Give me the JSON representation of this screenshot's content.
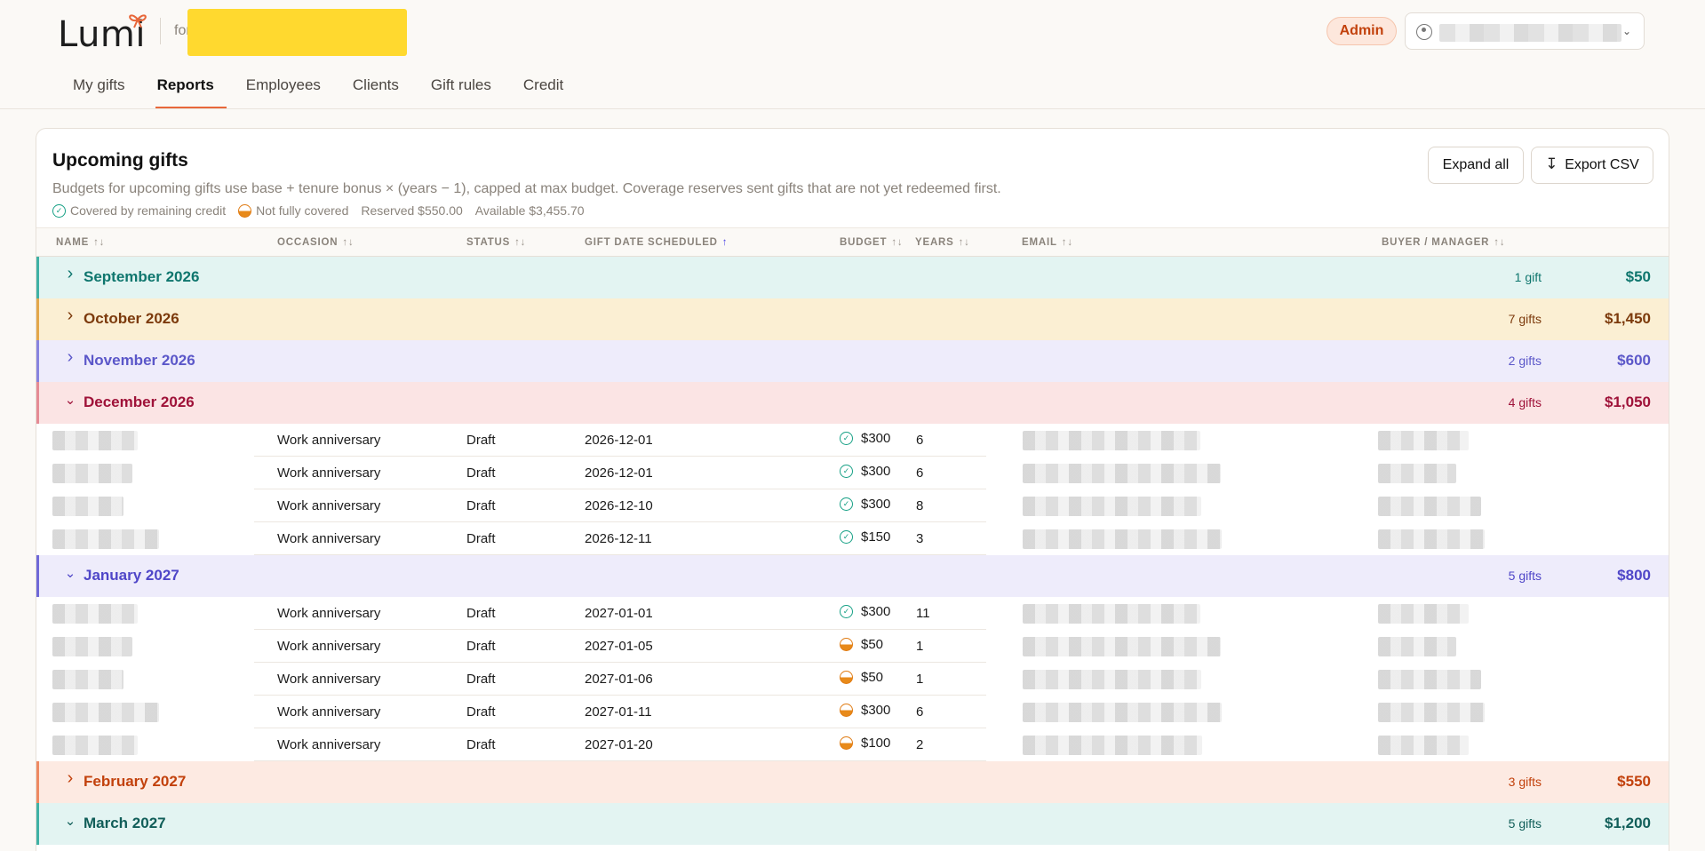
{
  "header": {
    "logo": "Lumi",
    "for_prefix": "for",
    "admin_badge": "Admin"
  },
  "nav": [
    {
      "label": "My gifts",
      "active": false
    },
    {
      "label": "Reports",
      "active": true
    },
    {
      "label": "Employees",
      "active": false
    },
    {
      "label": "Clients",
      "active": false
    },
    {
      "label": "Gift rules",
      "active": false
    },
    {
      "label": "Credit",
      "active": false
    }
  ],
  "card": {
    "title": "Upcoming gifts",
    "description": "Budgets for upcoming gifts use base + tenure bonus × (years − 1), capped at max budget. Coverage reserves sent gifts that are not yet redeemed first.",
    "legend": {
      "covered": "Covered by remaining credit",
      "not_covered": "Not fully covered",
      "reserved": "Reserved $550.00",
      "available": "Available $3,455.70"
    },
    "expand_all": "Expand all",
    "export_csv": "Export CSV"
  },
  "table": {
    "columns": [
      "NAME",
      "OCCASION",
      "STATUS",
      "GIFT DATE SCHEDULED",
      "BUDGET",
      "YEARS",
      "EMAIL",
      "BUYER / MANAGER"
    ],
    "groups": [
      {
        "month": "September 2026",
        "count": "1 gift",
        "total": "$50",
        "expanded": false,
        "color": "#0f766e",
        "bg": "#e3f4f2",
        "border": "#3fb1a5"
      },
      {
        "month": "October 2026",
        "count": "7 gifts",
        "total": "$1,450",
        "expanded": false,
        "color": "#7c3a0c",
        "bg": "#fbefd3",
        "border": "#e3a74a"
      },
      {
        "month": "November 2026",
        "count": "2 gifts",
        "total": "$600",
        "expanded": false,
        "color": "#5b57c9",
        "bg": "#eeecfb",
        "border": "#8884e0"
      },
      {
        "month": "December 2026",
        "count": "4 gifts",
        "total": "$1,050",
        "expanded": true,
        "color": "#9f1239",
        "bg": "#fbe4e4",
        "border": "#e58b95",
        "rows": [
          {
            "occasion": "Work anniversary",
            "status": "Draft",
            "date": "2026-12-01",
            "coverage": "covered",
            "budget": "$300",
            "years": "6"
          },
          {
            "occasion": "Work anniversary",
            "status": "Draft",
            "date": "2026-12-01",
            "coverage": "covered",
            "budget": "$300",
            "years": "6"
          },
          {
            "occasion": "Work anniversary",
            "status": "Draft",
            "date": "2026-12-10",
            "coverage": "covered",
            "budget": "$300",
            "years": "8"
          },
          {
            "occasion": "Work anniversary",
            "status": "Draft",
            "date": "2026-12-11",
            "coverage": "covered",
            "budget": "$150",
            "years": "3"
          }
        ]
      },
      {
        "month": "January 2027",
        "count": "5 gifts",
        "total": "$800",
        "expanded": true,
        "color": "#4f46c8",
        "bg": "#eeecfb",
        "border": "#6f69d8",
        "rows": [
          {
            "occasion": "Work anniversary",
            "status": "Draft",
            "date": "2027-01-01",
            "coverage": "covered",
            "budget": "$300",
            "years": "11"
          },
          {
            "occasion": "Work anniversary",
            "status": "Draft",
            "date": "2027-01-05",
            "coverage": "partial",
            "budget": "$50",
            "years": "1"
          },
          {
            "occasion": "Work anniversary",
            "status": "Draft",
            "date": "2027-01-06",
            "coverage": "partial",
            "budget": "$50",
            "years": "1"
          },
          {
            "occasion": "Work anniversary",
            "status": "Draft",
            "date": "2027-01-11",
            "coverage": "partial",
            "budget": "$300",
            "years": "6"
          },
          {
            "occasion": "Work anniversary",
            "status": "Draft",
            "date": "2027-01-20",
            "coverage": "partial",
            "budget": "$100",
            "years": "2"
          }
        ]
      },
      {
        "month": "February 2027",
        "count": "3 gifts",
        "total": "$550",
        "expanded": false,
        "color": "#c2410c",
        "bg": "#fdeae2",
        "border": "#ee8a62"
      },
      {
        "month": "March 2027",
        "count": "5 gifts",
        "total": "$1,200",
        "expanded": true,
        "color": "#115e59",
        "bg": "#e3f4f2",
        "border": "#3fb1a5",
        "rows": []
      }
    ]
  }
}
